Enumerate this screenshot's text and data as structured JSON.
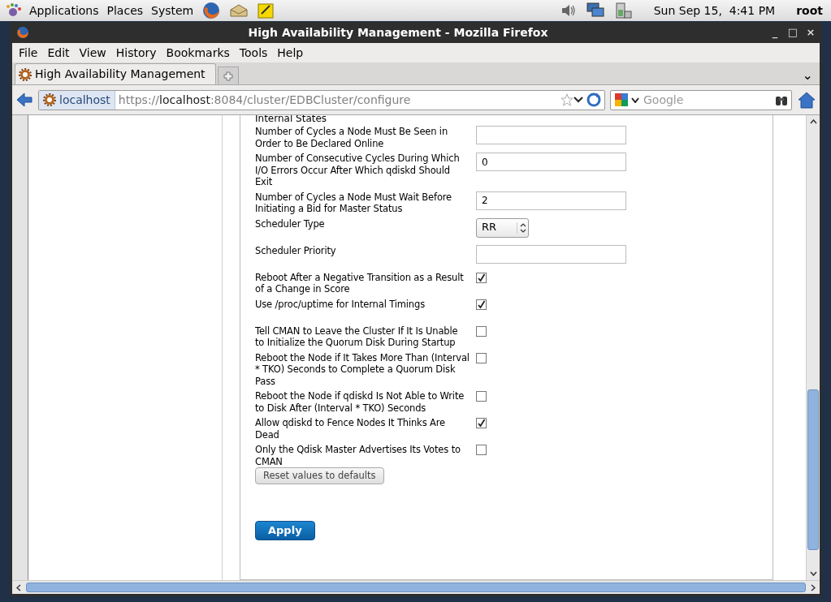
{
  "top_panel": {
    "menus": [
      "Applications",
      "Places",
      "System"
    ],
    "clock": "Sun Sep 15,  4:41 PM",
    "user": "root"
  },
  "window": {
    "title": "High Availability Management - Mozilla Firefox",
    "controls": [
      "_",
      "□",
      "×"
    ]
  },
  "menu": [
    "File",
    "Edit",
    "View",
    "History",
    "Bookmarks",
    "Tools",
    "Help"
  ],
  "tabs": [
    {
      "label": "High Availability Management",
      "selected": true
    }
  ],
  "tab_list_button": "⌄",
  "address": {
    "site": "localhost",
    "url_parts": [
      {
        "text": "https://",
        "kind": "dim"
      },
      {
        "text": "localhost",
        "kind": "host"
      },
      {
        "text": ":8084/cluster/EDBCluster/configure",
        "kind": "dim"
      }
    ]
  },
  "search": {
    "placeholder": "Google"
  },
  "form": {
    "cut_heading": "Internal States",
    "fields": [
      {
        "kind": "text",
        "label": "Number of Cycles a Node Must Be Seen in Order to Be Declared Online"
      },
      {
        "kind": "text",
        "label": "Number of Consecutive Cycles During Which I/O Errors Occur After Which qdiskd Should Exit",
        "value": "0"
      },
      {
        "kind": "text",
        "label": "Number of Cycles a Node Must Wait Before Initiating a Bid for Master Status",
        "value": "2"
      },
      {
        "kind": "select",
        "label": "Scheduler Type",
        "value": "RR"
      },
      {
        "kind": "text",
        "label": "Scheduler Priority"
      },
      {
        "kind": "checkbox",
        "label": "Reboot After a Negative Transition as a Result of a Change in Score",
        "checked": true
      },
      {
        "kind": "checkbox",
        "label": "Use /proc/uptime for Internal Timings",
        "checked": true
      },
      {
        "kind": "checkbox",
        "label": "Tell CMAN to Leave the Cluster If It Is Unable to Initialize the Quorum Disk During Startup",
        "checked": false
      },
      {
        "kind": "checkbox",
        "label": "Reboot the Node if It Takes More Than (Interval * TKO) Seconds to Complete a Quorum Disk Pass",
        "checked": false
      },
      {
        "kind": "checkbox",
        "label": "Reboot the Node if qdiskd Is Not Able to Write to Disk After (Interval * TKO) Seconds",
        "checked": false
      },
      {
        "kind": "checkbox",
        "label": "Allow qdiskd to Fence Nodes It Thinks Are Dead",
        "checked": true
      },
      {
        "kind": "checkbox",
        "label": "Only the Qdisk Master Advertises Its Votes to CMAN",
        "checked": false
      }
    ],
    "reset_button": "Reset values to defaults",
    "apply_button": "Apply"
  }
}
